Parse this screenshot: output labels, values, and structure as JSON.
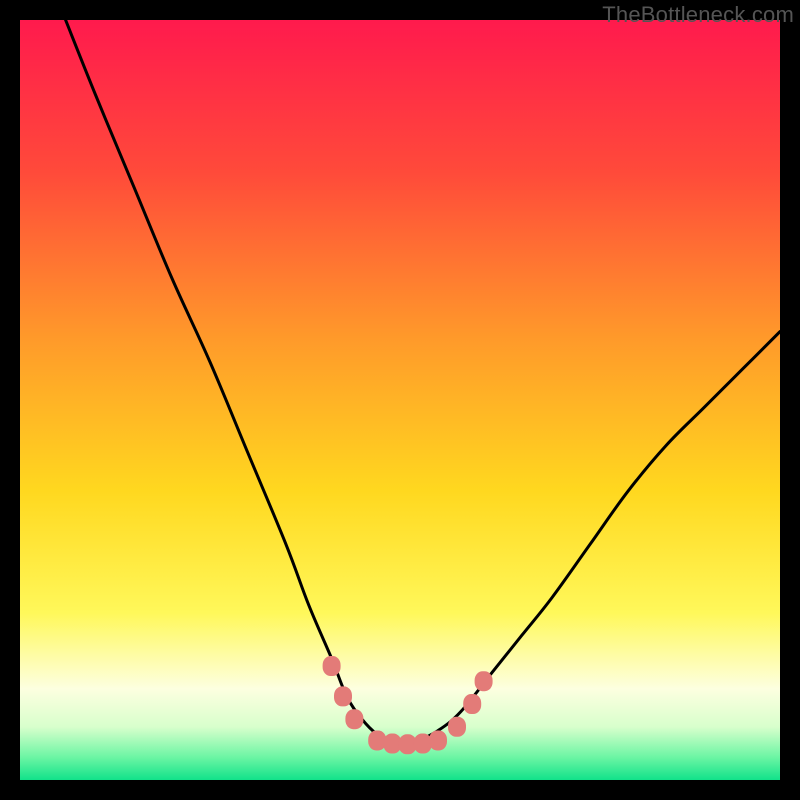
{
  "watermark": "TheBottleneck.com",
  "chart_data": {
    "type": "line",
    "title": "",
    "xlabel": "",
    "ylabel": "",
    "xlim": [
      0,
      100
    ],
    "ylim": [
      0,
      100
    ],
    "grid": false,
    "legend": false,
    "series": [
      {
        "name": "left-curve",
        "x": [
          6,
          10,
          15,
          20,
          25,
          30,
          35,
          38,
          41,
          43,
          45,
          47,
          49,
          50
        ],
        "y": [
          100,
          90,
          78,
          66,
          55,
          43,
          31,
          23,
          16,
          11,
          8,
          6,
          5,
          4.5
        ]
      },
      {
        "name": "right-curve",
        "x": [
          50,
          52,
          55,
          58,
          62,
          66,
          70,
          75,
          80,
          85,
          90,
          95,
          100
        ],
        "y": [
          4.5,
          5,
          6.5,
          9,
          14,
          19,
          24,
          31,
          38,
          44,
          49,
          54,
          59
        ]
      }
    ],
    "markers": {
      "name": "trough-dots",
      "color": "#e37b78",
      "points": [
        {
          "x": 41,
          "y": 15
        },
        {
          "x": 42.5,
          "y": 11
        },
        {
          "x": 44,
          "y": 8
        },
        {
          "x": 47,
          "y": 5.2
        },
        {
          "x": 49,
          "y": 4.8
        },
        {
          "x": 51,
          "y": 4.7
        },
        {
          "x": 53,
          "y": 4.8
        },
        {
          "x": 55,
          "y": 5.2
        },
        {
          "x": 57.5,
          "y": 7
        },
        {
          "x": 59.5,
          "y": 10
        },
        {
          "x": 61,
          "y": 13
        }
      ]
    },
    "background_gradient": {
      "type": "vertical",
      "stops": [
        {
          "pos": 0.0,
          "color": "#ff1a4d"
        },
        {
          "pos": 0.2,
          "color": "#ff4a3a"
        },
        {
          "pos": 0.42,
          "color": "#ff9a2a"
        },
        {
          "pos": 0.62,
          "color": "#ffd81f"
        },
        {
          "pos": 0.78,
          "color": "#fff85a"
        },
        {
          "pos": 0.88,
          "color": "#fdffe0"
        },
        {
          "pos": 0.93,
          "color": "#d8ffcc"
        },
        {
          "pos": 0.97,
          "color": "#6cf5a4"
        },
        {
          "pos": 1.0,
          "color": "#11e28a"
        }
      ]
    }
  }
}
